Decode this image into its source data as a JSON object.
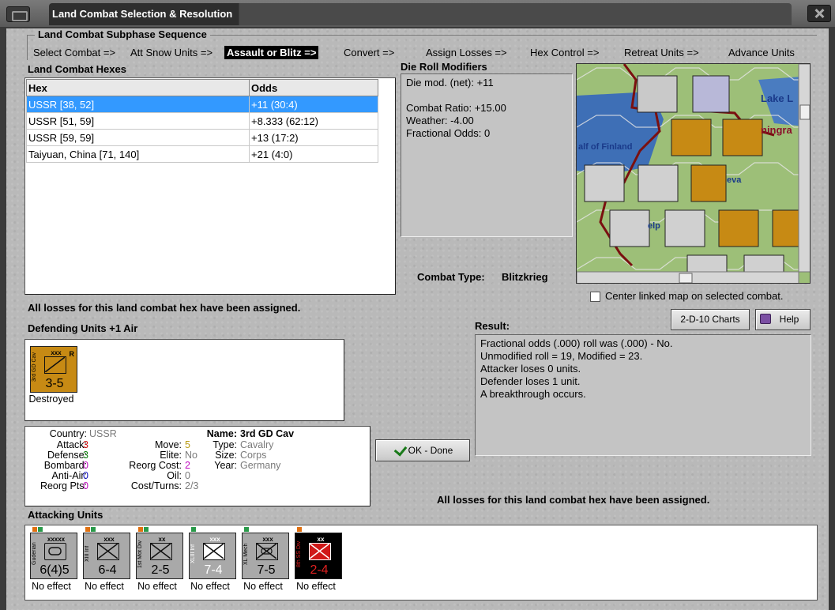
{
  "window": {
    "title": "Land Combat Selection & Resolution"
  },
  "sequence": {
    "title": "Land Combat Subphase Sequence",
    "steps": [
      "Select Combat =>",
      "Att Snow Units =>",
      "Assault or Blitz =>",
      "Convert =>",
      "Assign Losses =>",
      "Hex Control =>",
      "Retreat Units =>",
      "Advance Units"
    ],
    "active_index": 2
  },
  "combat_hexes": {
    "title": "Land Combat Hexes",
    "columns": [
      "Hex",
      "Odds"
    ],
    "rows": [
      {
        "hex": "USSR [38, 52]",
        "odds": "+11 (30:4)",
        "selected": true
      },
      {
        "hex": "USSR [51, 59]",
        "odds": "+8.333 (62:12)"
      },
      {
        "hex": "USSR [59, 59]",
        "odds": "+13 (17:2)"
      },
      {
        "hex": "Taiyuan, China [71, 140]",
        "odds": "+21 (4:0)"
      }
    ]
  },
  "die_roll_modifiers": {
    "title": "Die Roll Modifiers",
    "lines": [
      "Die mod. (net): +11",
      "",
      "Combat Ratio: +15.00",
      "Weather: -4.00",
      "Fractional Odds: 0"
    ]
  },
  "map": {
    "labels": [
      "Lake L",
      "ningra",
      "alf of Finland",
      "eva",
      "elp"
    ]
  },
  "combat_type": {
    "label": "Combat Type:",
    "value": "Blitzkrieg"
  },
  "center_map": {
    "label": "Center linked map on selected combat.",
    "checked": false
  },
  "buttons": {
    "charts": "2-D-10 Charts",
    "help": "Help",
    "ok": "OK - Done"
  },
  "losses_assigned": "All losses for this land combat hex have been assigned.",
  "defending": {
    "title": "Defending Units +1 Air",
    "units": [
      {
        "side_text": "3rd GD Cav",
        "size": "xxx",
        "flag": "R",
        "strength": "3-5",
        "status": "Destroyed",
        "color": "#c78a14"
      }
    ]
  },
  "result": {
    "title": "Result:",
    "lines": [
      "Fractional odds (.000) roll was (.000)  - No.",
      "Unmodified roll = 19, Modified = 23.",
      "Attacker loses 0 units.",
      "Defender loses 1 unit.",
      "A breakthrough occurs."
    ]
  },
  "unit_details": {
    "country_label": "Country:",
    "country": "USSR",
    "attack_label": "Attack:",
    "attack": "3",
    "defense_label": "Defense:",
    "defense": "3",
    "bombard_label": "Bombard:",
    "bombard": "0",
    "anti_air_label": "Anti-Air:",
    "anti_air": "0",
    "reorg_pts_label": "Reorg Pts:",
    "reorg_pts": "0",
    "move_label": "Move:",
    "move": "5",
    "elite_label": "Elite:",
    "elite": "No",
    "reorg_cost_label": "Reorg Cost:",
    "reorg_cost": "2",
    "oil_label": "Oil:",
    "oil": "0",
    "cost_turns_label": "Cost/Turns:",
    "cost_turns": "2/3",
    "name_label": "Name:",
    "name": "3rd GD Cav",
    "type_label": "Type:",
    "type": "Cavalry",
    "size_label": "Size:",
    "size": "Corps",
    "year_label": "Year:",
    "year": "Germany"
  },
  "attacking": {
    "title": "Attacking Units",
    "units": [
      {
        "side_text": "Guderian",
        "size": "xxxxx",
        "strength": "6(4)5",
        "status": "No effect",
        "color": "#a9a9a9"
      },
      {
        "side_text": "XIII Inf",
        "size": "xxx",
        "strength": "6-4",
        "status": "No effect",
        "color": "#a9a9a9"
      },
      {
        "side_text": "1st Mot Div",
        "size": "xx",
        "strength": "2-5",
        "status": "No effect",
        "color": "#a9a9a9"
      },
      {
        "side_text": "XLIII Inf",
        "size": "xxx",
        "strength": "7-4",
        "status": "No effect",
        "color": "#a9a9a9"
      },
      {
        "side_text": "XL Mech",
        "size": "xxx",
        "strength": "7-5",
        "status": "No effect",
        "color": "#a9a9a9"
      },
      {
        "side_text": "8th SS Div",
        "size": "xx",
        "strength": "2-4",
        "status": "No effect",
        "color": "#000000"
      }
    ]
  }
}
